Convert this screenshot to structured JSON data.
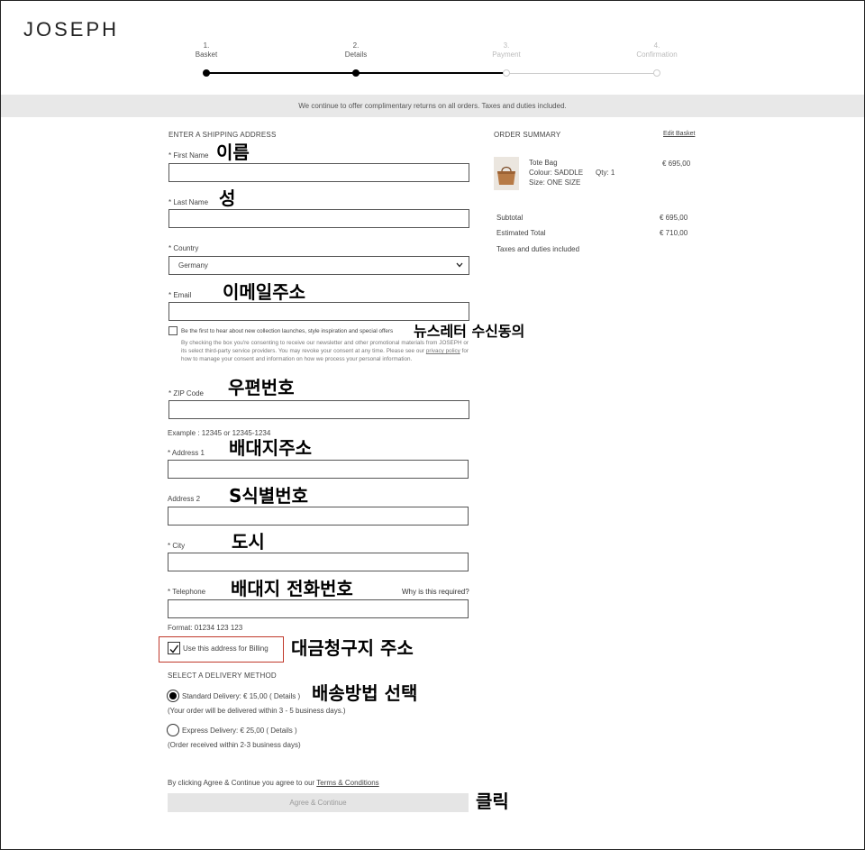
{
  "brand": "JOSEPH",
  "steps": [
    {
      "num": "1.",
      "label": "Basket"
    },
    {
      "num": "2.",
      "label": "Details"
    },
    {
      "num": "3.",
      "label": "Payment"
    },
    {
      "num": "4.",
      "label": "Confirmation"
    }
  ],
  "banner": "We continue to offer complimentary returns on all orders. Taxes and duties included.",
  "shipping": {
    "title": "ENTER A SHIPPING ADDRESS",
    "first_name": "* First Name",
    "last_name": "* Last Name",
    "country": "* Country",
    "country_value": "Germany",
    "email": "* Email",
    "newsletter_label": "Be the first to hear about new collection launches, style inspiration and special offers",
    "consent_text_1": "By checking the box you're consenting to receive our newsletter and other promotional materials from JOSEPH or its select third-party service providers. You may revoke your consent at any time. Please see our",
    "privacy_link": "privacy policy",
    "consent_text_2": "for how to manage your consent and information on how we process your personal information.",
    "zip": "* ZIP Code",
    "zip_example": "Example : 12345 or 12345-1234",
    "address1": "* Address 1",
    "address2": "Address 2",
    "city": "* City",
    "telephone": "* Telephone",
    "why_required": "Why is this required?",
    "phone_format": "Format: 01234 123 123",
    "billing_label": "Use this address for Billing"
  },
  "delivery": {
    "title": "SELECT A DELIVERY METHOD",
    "standard": "Standard Delivery: € 15,00 ( Details )",
    "standard_note": "(Your order will be delivered within 3 - 5 business days.)",
    "express": "Express Delivery: € 25,00 ( Details )",
    "express_note": "(Order received within 2-3 business days)"
  },
  "agree_text": "By clicking Agree & Continue you agree to our",
  "terms_link": "Terms & Conditions",
  "continue_button": "Agree & Continue",
  "summary": {
    "title": "ORDER SUMMARY",
    "edit": "Edit Basket",
    "item_name": "Tote Bag",
    "item_colour": "Colour: SADDLE",
    "item_size": "Size: ONE SIZE",
    "item_qty": "Qty: 1",
    "item_price": "€ 695,00",
    "subtotal_label": "Subtotal",
    "subtotal_value": "€ 695,00",
    "total_label": "Estimated Total",
    "total_value": "€ 710,00",
    "taxes_note": "Taxes and duties included"
  },
  "annotations": {
    "first_name": "이름",
    "last_name": "성",
    "email": "이메일주소",
    "newsletter": "뉴스레터 수신동의",
    "zip": "우편번호",
    "address1": "배대지주소",
    "address2": "S식별번호",
    "city": "도시",
    "telephone": "배대지 전화번호",
    "billing": "대금청구지 주소",
    "delivery": "배송방법 선택",
    "click": "클릭"
  },
  "colors": {
    "accent_box": "#c0392b",
    "banner_bg": "#e8e8e8",
    "active_step": "#000000",
    "inactive_step": "#cccccc"
  }
}
